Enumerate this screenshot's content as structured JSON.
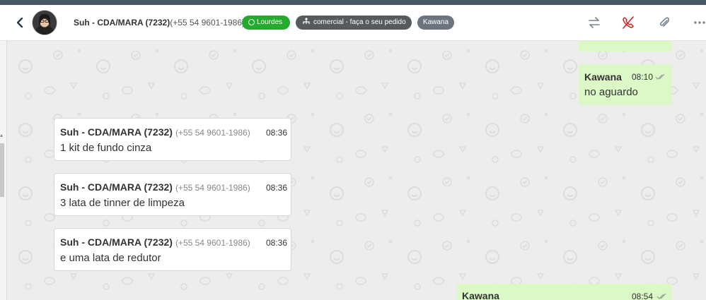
{
  "header": {
    "contact_name": "Suh - CDA/MARA (7232)",
    "contact_phone": "(+55 54 9601-1986)",
    "tags": {
      "agent": "Lourdes",
      "department": "comercial - faça o seu pedido",
      "user": "Kawana"
    },
    "icons": [
      "back-arrow-icon",
      "transfer-icon",
      "end-call-icon",
      "paperclip-icon",
      "more-options-icon"
    ],
    "colors": {
      "agent_tag": "#25a92f",
      "department_tag": "#555a5e",
      "user_tag": "#6c757d",
      "end_call_icon": "#c62828"
    }
  },
  "messages": [
    {
      "direction": "out",
      "sender": "Kawana",
      "time": "08:10",
      "text": "no aguardo",
      "status": "read"
    },
    {
      "direction": "in",
      "sender": "Suh - CDA/MARA (7232)",
      "phone": "(+55 54 9601-1986)",
      "time": "08:36",
      "text": "1 kit de fundo cinza"
    },
    {
      "direction": "in",
      "sender": "Suh - CDA/MARA (7232)",
      "phone": "(+55 54 9601-1986)",
      "time": "08:36",
      "text": "3 lata de tinner de limpeza"
    },
    {
      "direction": "in",
      "sender": "Suh - CDA/MARA (7232)",
      "phone": "(+55 54 9601-1986)",
      "time": "08:36",
      "text": "e uma lata de redutor"
    },
    {
      "direction": "out",
      "sender": "Kawana",
      "time": "08:54",
      "text": "",
      "status": "read"
    }
  ],
  "colors": {
    "outgoing_bubble": "#dcf8c6",
    "incoming_bubble": "#ffffff",
    "chat_background": "#ededed"
  }
}
